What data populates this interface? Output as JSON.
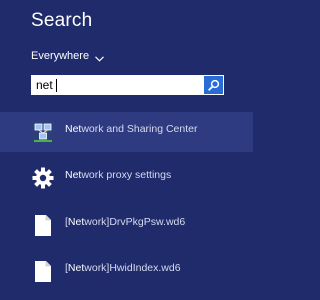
{
  "search": {
    "title": "Search",
    "scope": "Everywhere",
    "query": "net"
  },
  "results": [
    {
      "prefix": "Net",
      "rest": "work and Sharing Center",
      "icon": "network-center-icon",
      "selected": true
    },
    {
      "prefix": "Net",
      "rest": "work proxy settings",
      "icon": "gear-icon",
      "selected": false
    },
    {
      "prefix": "[",
      "highlight": "Net",
      "rest": "work]DrvPkgPsw.wd6",
      "icon": "file-icon",
      "selected": false
    },
    {
      "prefix": "[",
      "highlight": "Net",
      "rest": "work]HwidIndex.wd6",
      "icon": "file-icon",
      "selected": false
    }
  ],
  "colors": {
    "background": "#1f2b6b",
    "selected_row": "#2f3b80",
    "search_button": "#2a6cd6"
  }
}
